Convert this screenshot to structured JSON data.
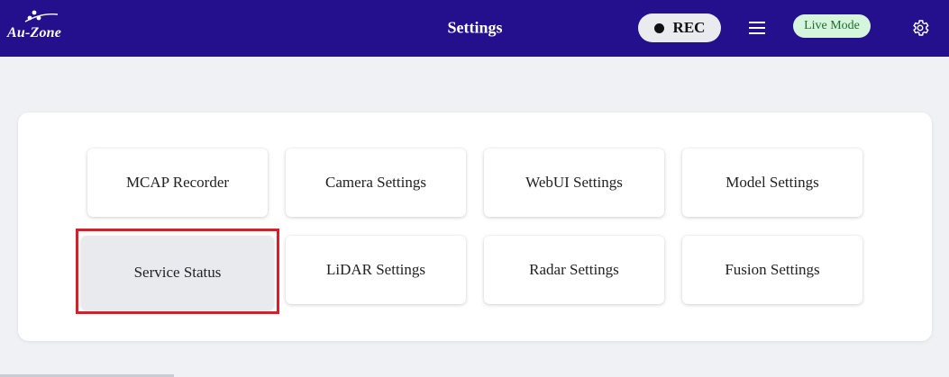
{
  "header": {
    "logo_text": "Au-Zone",
    "title": "Settings",
    "rec_label": "REC",
    "mode_badge": "Live Mode"
  },
  "colors": {
    "header_bg": "#24108c",
    "page_bg": "#f0f1f4",
    "highlight": "#d71f2b",
    "badge_bg": "#d6f5dd",
    "badge_text": "#1f6b30"
  },
  "icons": {
    "menu": "hamburger-menu-icon",
    "settings": "gear-icon",
    "record": "record-dot-icon"
  },
  "settings_cards": [
    {
      "label": "MCAP Recorder",
      "active": false
    },
    {
      "label": "Camera Settings",
      "active": false
    },
    {
      "label": "WebUI Settings",
      "active": false
    },
    {
      "label": "Model Settings",
      "active": false
    },
    {
      "label": "Service Status",
      "active": true
    },
    {
      "label": "LiDAR Settings",
      "active": false
    },
    {
      "label": "Radar Settings",
      "active": false
    },
    {
      "label": "Fusion Settings",
      "active": false
    }
  ]
}
